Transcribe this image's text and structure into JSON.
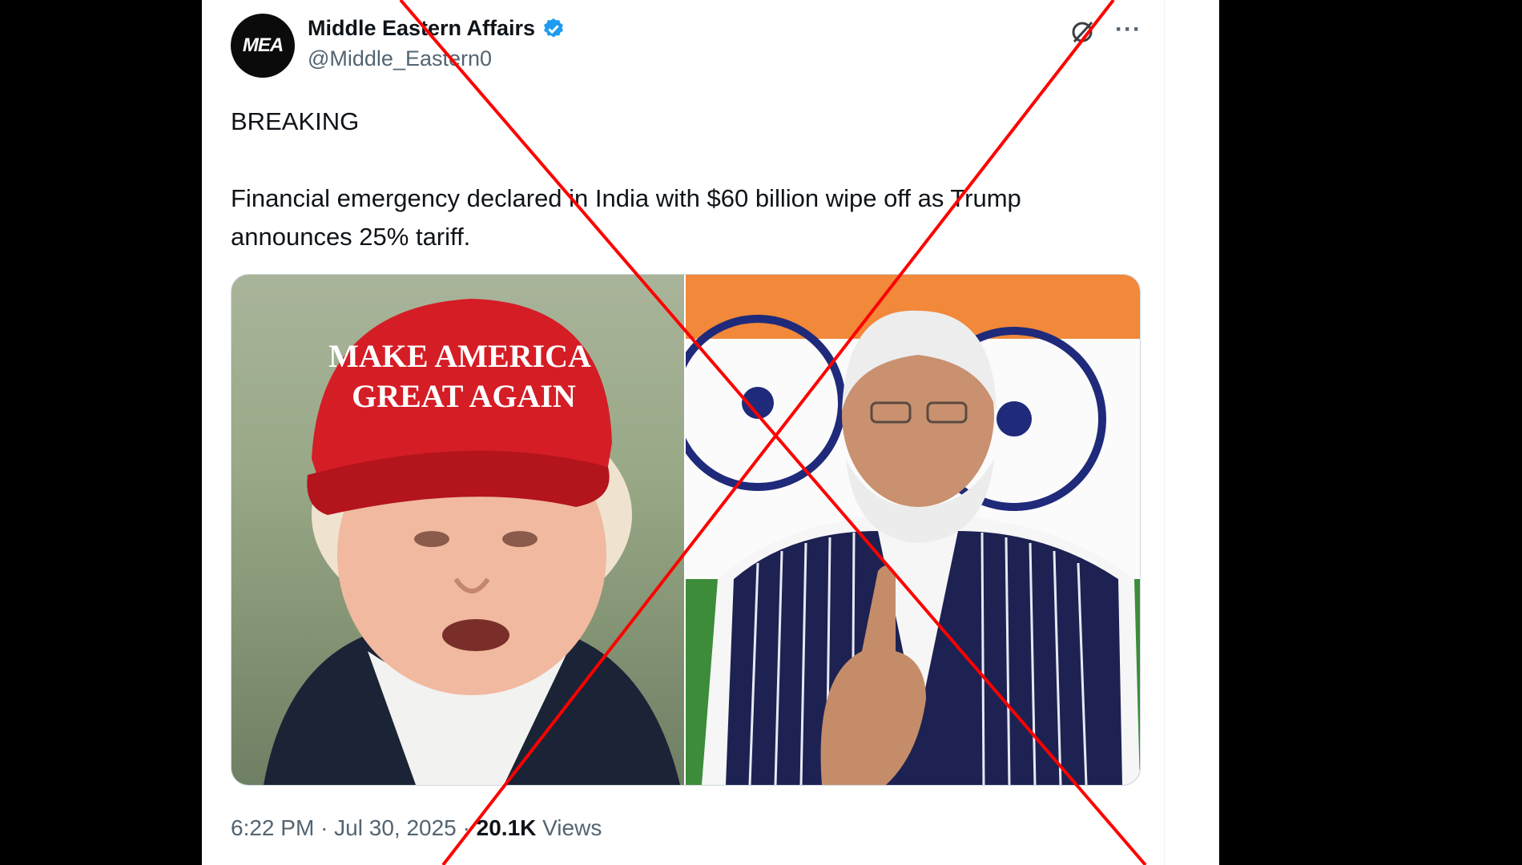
{
  "author": {
    "avatar_text": "MEA",
    "name": "Middle Eastern Affairs",
    "handle": "@Middle_Eastern0",
    "verified_icon": "verified-badge-icon",
    "badge_color": "#1d9bf0"
  },
  "actions": {
    "grok_icon": "grok-icon",
    "more_label": "···"
  },
  "tweet": {
    "line1": "BREAKING",
    "line2": "Financial emergency declared in India with $60 billion wipe off as Trump announces 25% tariff."
  },
  "media": {
    "left_photo": "Trump wearing red cap",
    "cap_line1": "MAKE AMERICA",
    "cap_line2": "GREAT AGAIN",
    "right_photo": "Modi in front of Indian flags"
  },
  "meta": {
    "time": "6:22 PM",
    "date": "Jul 30, 2025",
    "views_count": "20.1K",
    "views_label": "Views"
  },
  "overlay": {
    "cross_color": "#ff0000"
  }
}
